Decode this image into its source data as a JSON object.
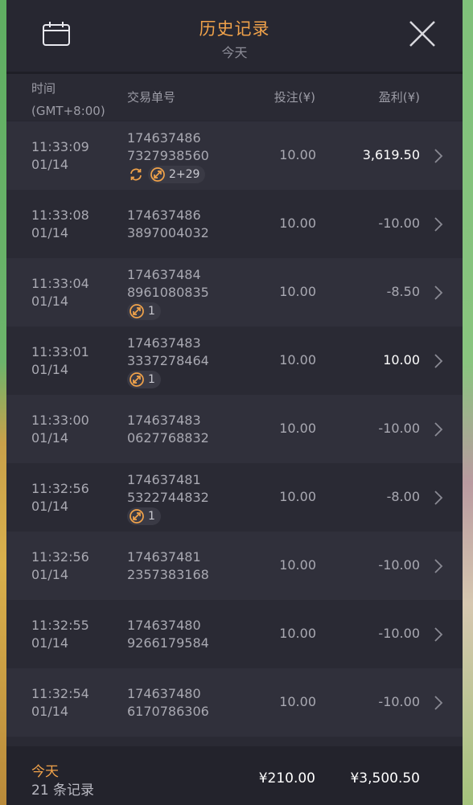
{
  "header": {
    "title": "历史记录",
    "subtitle": "今天",
    "calendar_icon": "calendar-icon",
    "close_icon": "close-icon"
  },
  "columns": {
    "time": "时间",
    "timezone": "(GMT+8:00)",
    "order": "交易单号",
    "bet": "投注(¥)",
    "profit": "盈利(¥)"
  },
  "rows": [
    {
      "time": "11:33:09",
      "date": "01/14",
      "order_a": "174637486",
      "order_b": "7327938560",
      "bet": "10.00",
      "profit": "3,619.50",
      "win": true,
      "tags": [
        {
          "icon": "refresh-icon",
          "plain": true,
          "label": ""
        },
        {
          "icon": "free-spin-icon",
          "label": "2+29"
        }
      ]
    },
    {
      "time": "11:33:08",
      "date": "01/14",
      "order_a": "174637486",
      "order_b": "3897004032",
      "bet": "10.00",
      "profit": "-10.00",
      "win": false,
      "tags": []
    },
    {
      "time": "11:33:04",
      "date": "01/14",
      "order_a": "174637484",
      "order_b": "8961080835",
      "bet": "10.00",
      "profit": "-8.50",
      "win": false,
      "tags": [
        {
          "icon": "free-spin-icon",
          "label": "1"
        }
      ]
    },
    {
      "time": "11:33:01",
      "date": "01/14",
      "order_a": "174637483",
      "order_b": "3337278464",
      "bet": "10.00",
      "profit": "10.00",
      "win": true,
      "tags": [
        {
          "icon": "free-spin-icon",
          "label": "1"
        }
      ]
    },
    {
      "time": "11:33:00",
      "date": "01/14",
      "order_a": "174637483",
      "order_b": "0627768832",
      "bet": "10.00",
      "profit": "-10.00",
      "win": false,
      "tags": []
    },
    {
      "time": "11:32:56",
      "date": "01/14",
      "order_a": "174637481",
      "order_b": "5322744832",
      "bet": "10.00",
      "profit": "-8.00",
      "win": false,
      "tags": [
        {
          "icon": "free-spin-icon",
          "label": "1"
        }
      ]
    },
    {
      "time": "11:32:56",
      "date": "01/14",
      "order_a": "174637481",
      "order_b": "2357383168",
      "bet": "10.00",
      "profit": "-10.00",
      "win": false,
      "tags": []
    },
    {
      "time": "11:32:55",
      "date": "01/14",
      "order_a": "174637480",
      "order_b": "9266179584",
      "bet": "10.00",
      "profit": "-10.00",
      "win": false,
      "tags": []
    },
    {
      "time": "11:32:54",
      "date": "01/14",
      "order_a": "174637480",
      "order_b": "6170786306",
      "bet": "10.00",
      "profit": "-10.00",
      "win": false,
      "tags": []
    },
    {
      "time": "",
      "date": "",
      "order_a": "",
      "order_b": "",
      "bet": "",
      "profit": "",
      "win": false,
      "tags": []
    }
  ],
  "footer": {
    "label": "今天",
    "count": "21 条记录",
    "total_bet": "¥210.00",
    "total_profit": "¥3,500.50"
  },
  "colors": {
    "accent": "#f0a24a",
    "panel": "#272731",
    "row_odd": "#30303b",
    "row_even": "#2a2a34"
  }
}
